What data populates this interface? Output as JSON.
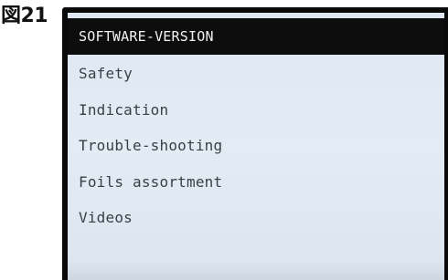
{
  "figure_label": "図21",
  "menu": {
    "items": [
      {
        "label": "SOFTWARE-VERSION",
        "selected": true
      },
      {
        "label": "Safety",
        "selected": false
      },
      {
        "label": "Indication",
        "selected": false
      },
      {
        "label": "Trouble-shooting",
        "selected": false
      },
      {
        "label": "Foils assortment",
        "selected": false
      },
      {
        "label": "Videos",
        "selected": false
      }
    ]
  },
  "colors": {
    "screen_background": "#e0e8f1",
    "selection_background": "#0d0d0d",
    "selection_text": "#f2f2f2",
    "item_text": "#3a3f45",
    "device_frame": "#0a0a0a"
  }
}
